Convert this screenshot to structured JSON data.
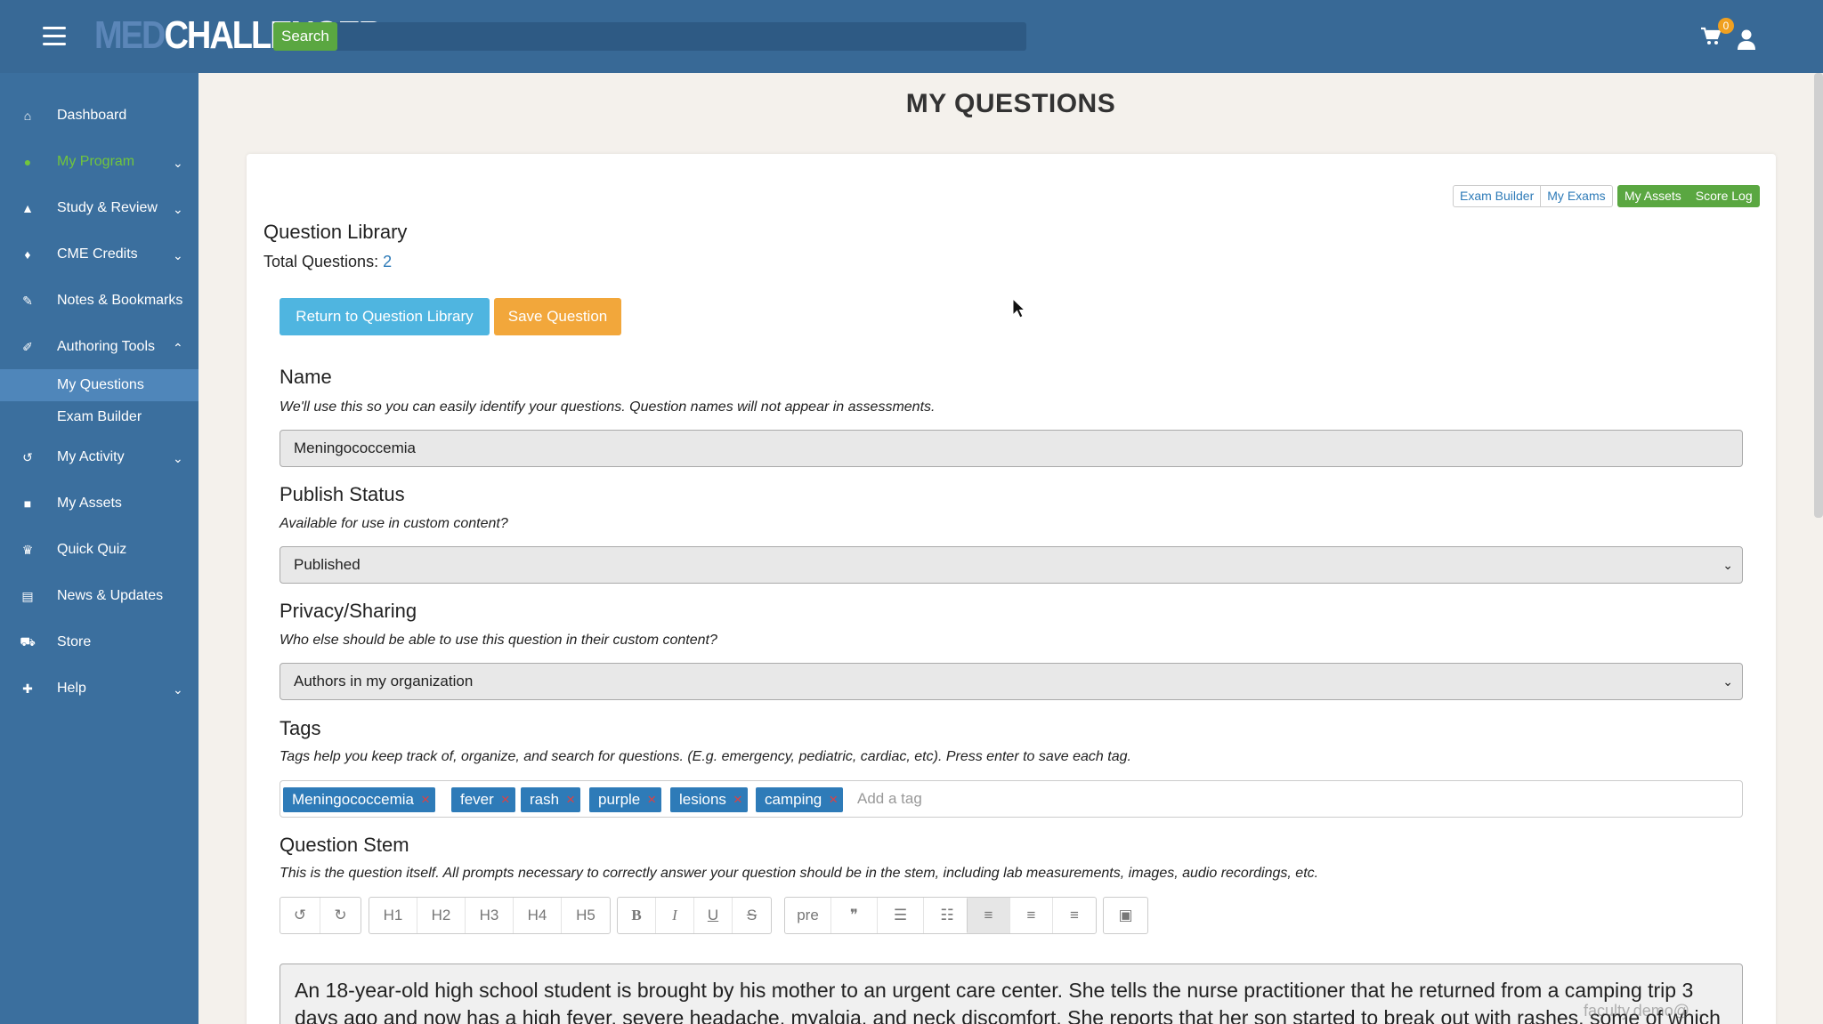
{
  "header": {
    "logo_part1": "MED",
    "logo_part2": "CHALLENGER",
    "search_label": "Search",
    "cart_count": "0"
  },
  "sidebar": {
    "items": [
      {
        "label": "Dashboard",
        "icon": "home-icon"
      },
      {
        "label": "My Program",
        "icon": "users-icon"
      },
      {
        "label": "Study & Review",
        "icon": "graduation-cap-icon"
      },
      {
        "label": "CME Credits",
        "icon": "bell-icon"
      },
      {
        "label": "Notes & Bookmarks",
        "icon": "pin-icon"
      },
      {
        "label": "Authoring Tools",
        "icon": "edit-icon"
      },
      {
        "label": "My Activity",
        "icon": "history-icon"
      },
      {
        "label": "My Assets",
        "icon": "book-icon"
      },
      {
        "label": "Quick Quiz",
        "icon": "trophy-icon"
      },
      {
        "label": "News & Updates",
        "icon": "newspaper-icon"
      },
      {
        "label": "Store",
        "icon": "cart-icon"
      },
      {
        "label": "Help",
        "icon": "ambulance-icon"
      }
    ],
    "sub_items": [
      {
        "label": "My Questions"
      },
      {
        "label": "Exam Builder"
      }
    ]
  },
  "main": {
    "page_title": "MY QUESTIONS",
    "top_buttons": {
      "exam_builder": "Exam Builder",
      "my_exams": "My Exams",
      "my_assets": "My Assets",
      "score_log": "Score Log"
    },
    "library_title": "Question Library",
    "total_label": "Total Questions:",
    "total_value": "2",
    "return_button": "Return to Question Library",
    "save_button": "Save Question",
    "name": {
      "heading": "Name",
      "description": "We'll use this so you can easily identify your questions. Question names will not appear in assessments.",
      "value": "Meningococcemia"
    },
    "publish": {
      "heading": "Publish Status",
      "description": "Available for use in custom content?",
      "value": "Published"
    },
    "privacy": {
      "heading": "Privacy/Sharing",
      "description": "Who else should be able to use this question in their custom content?",
      "value": "Authors in my organization"
    },
    "tags": {
      "heading": "Tags",
      "description": "Tags help you keep track of, organize, and search for questions. (E.g. emergency, pediatric, cardiac, etc). Press enter to save each tag.",
      "items": [
        "Meningococcemia",
        "fever",
        "rash",
        "purple",
        "lesions",
        "camping"
      ],
      "placeholder": "Add a tag"
    },
    "stem": {
      "heading": "Question Stem",
      "description": "This is the question itself. All prompts necessary to correctly answer your question should be in the stem, including lab measurements, images, audio recordings, etc.",
      "toolbar": {
        "undo": "↺",
        "redo": "↻",
        "h1": "H1",
        "h2": "H2",
        "h3": "H3",
        "h4": "H4",
        "h5": "H5",
        "bold": "B",
        "italic": "I",
        "underline": "U",
        "strike": "S",
        "pre": "pre",
        "quote": "❞",
        "ul": "☰",
        "ol": "☷",
        "align_left": "≡",
        "align_center": "≡",
        "align_right": "≡",
        "image": "▣"
      },
      "text": "An 18-year-old high school student is brought by his mother to an urgent care center. She tells the nurse practitioner that he returned from a camping trip 3 days ago and now has a high fever, severe headache, myalgia, and neck discomfort. She reports that her son started to break out with rashes, some of which"
    },
    "watermark": "faculty.demo@..."
  }
}
